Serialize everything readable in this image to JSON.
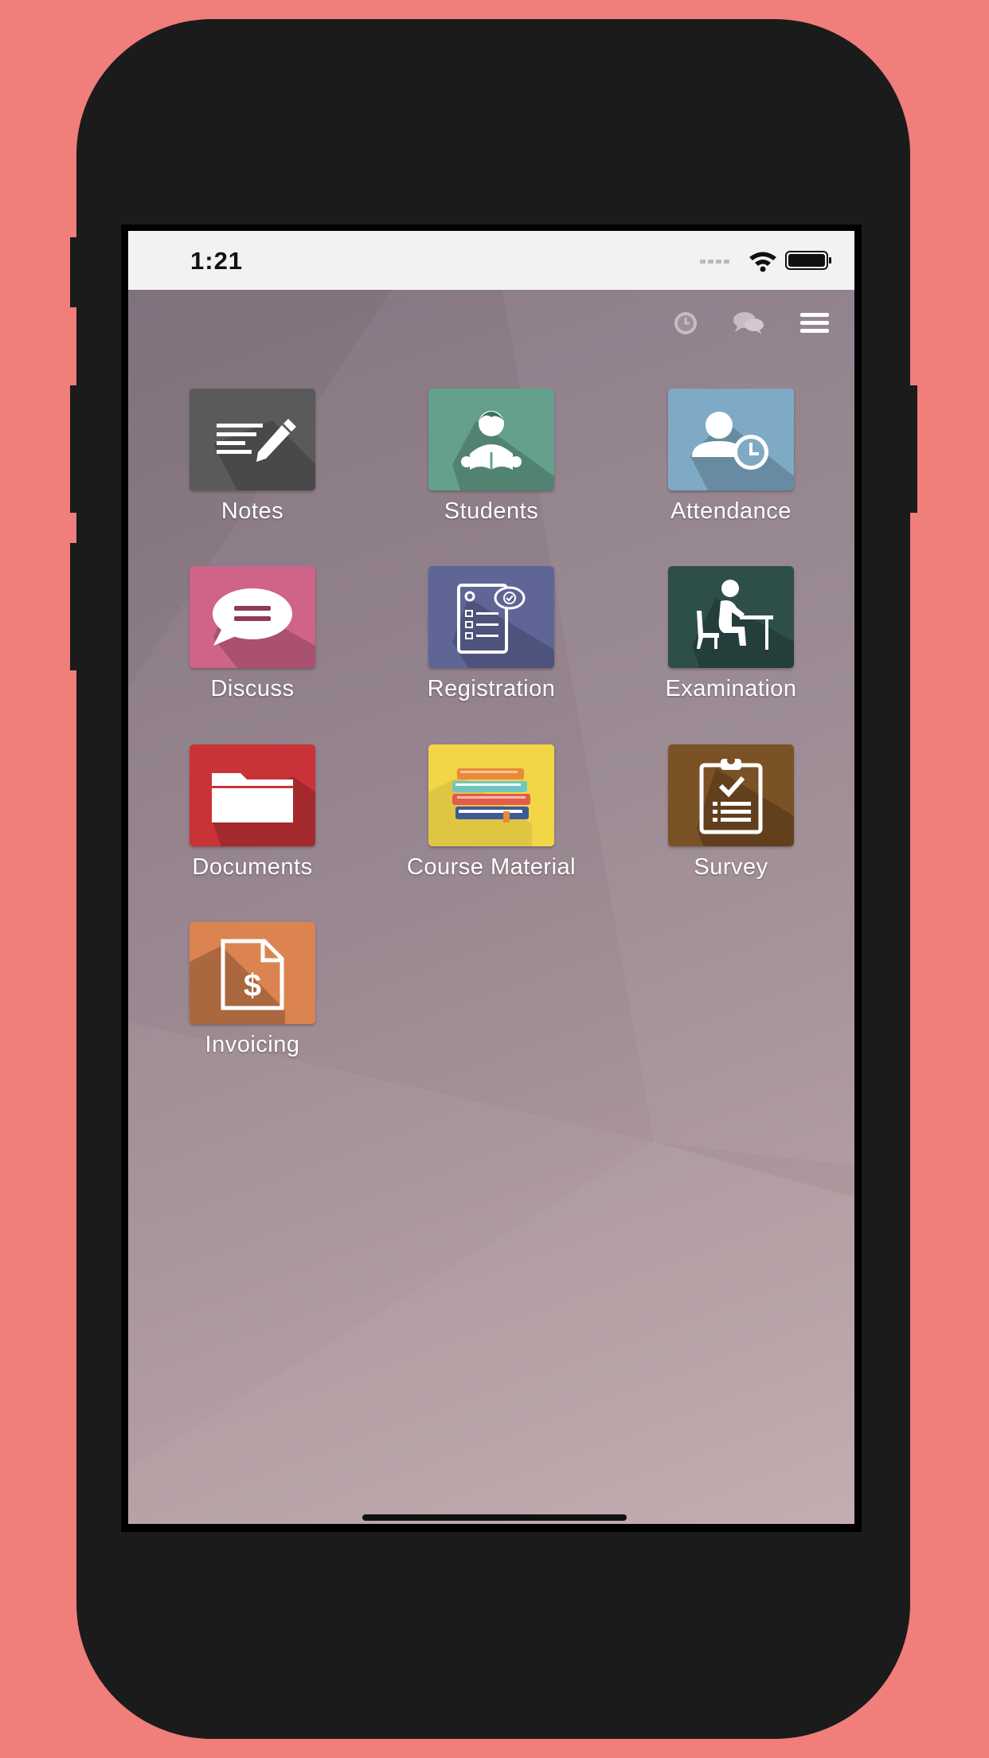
{
  "status_bar": {
    "time": "1:21",
    "icons": [
      "signal-dots-icon",
      "wifi-icon",
      "battery-icon"
    ]
  },
  "topbar": {
    "icons": [
      "activity-clock-icon",
      "chat-bubbles-icon",
      "hamburger-menu-icon"
    ]
  },
  "apps": [
    {
      "label": "Notes",
      "icon": "notes-pencil-icon",
      "color": "#5A5A5A"
    },
    {
      "label": "Students",
      "icon": "student-reading-icon",
      "color": "#64A08C"
    },
    {
      "label": "Attendance",
      "icon": "user-clock-icon",
      "color": "#7FAAC5"
    },
    {
      "label": "Discuss",
      "icon": "speech-bubble-icon",
      "color": "#CF6388"
    },
    {
      "label": "Registration",
      "icon": "checklist-form-icon",
      "color": "#5F6696"
    },
    {
      "label": "Examination",
      "icon": "student-desk-icon",
      "color": "#2E4E4A"
    },
    {
      "label": "Documents",
      "icon": "folder-icon",
      "color": "#C93337"
    },
    {
      "label": "Course Material",
      "icon": "books-stack-icon",
      "color": "#F3D648"
    },
    {
      "label": "Survey",
      "icon": "clipboard-check-icon",
      "color": "#7B5126"
    },
    {
      "label": "Invoicing",
      "icon": "dollar-document-icon",
      "color": "#DB8450"
    }
  ]
}
